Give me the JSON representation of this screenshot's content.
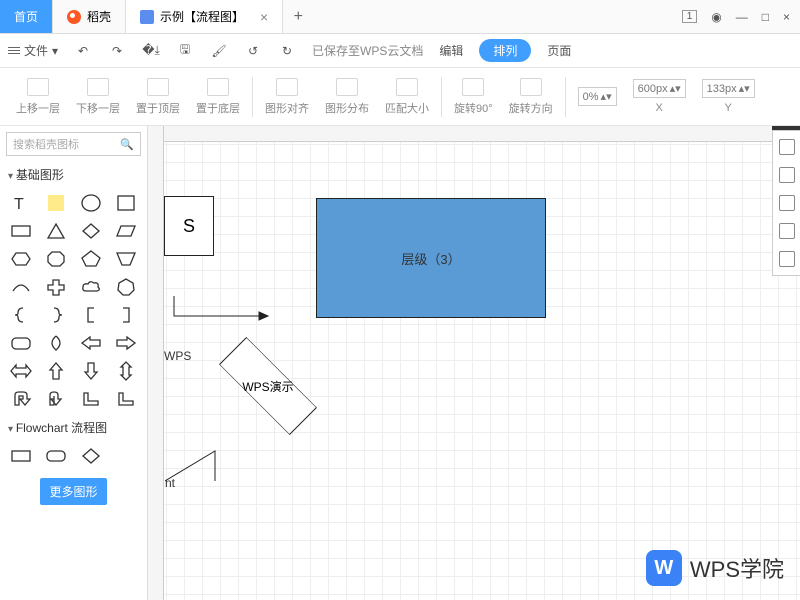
{
  "titlebar": {
    "home": "首页",
    "daoke": "稻壳",
    "doc": "示例【流程图】",
    "pagenum": "1"
  },
  "menubar": {
    "file": "文件",
    "savestat": "已保存至WPS云文档",
    "edit": "编辑",
    "arrange": "排列",
    "page": "页面"
  },
  "ribbon": {
    "up": "上移一层",
    "down": "下移一层",
    "top": "置于顶层",
    "bottom": "置于底层",
    "align": "图形对齐",
    "distribute": "图形分布",
    "fitsize": "匹配大小",
    "rotate90": "旋转90°",
    "rotatedir": "旋转方向",
    "pct": "0%",
    "x": "X",
    "xval": "600px",
    "y": "Y",
    "yval": "133px"
  },
  "sidepanel": {
    "search_ph": "搜索稻壳图标",
    "cat_basic": "基础图形",
    "cat_flow": "Flowchart 流程图",
    "more": "更多图形"
  },
  "canvas": {
    "rectS": "S",
    "blue": "层级（3）",
    "diamond": "WPS演示",
    "wps_lbl": "WPS",
    "nt": "nt"
  },
  "watermark": {
    "badge": "W",
    "text": "WPS学院"
  }
}
